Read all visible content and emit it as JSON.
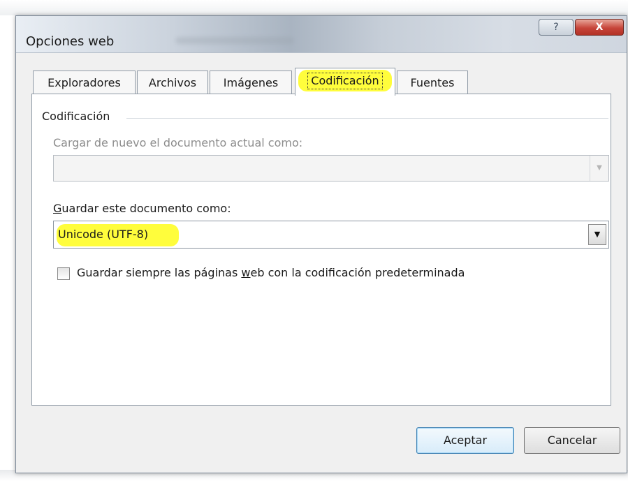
{
  "window": {
    "title": "Opciones web",
    "help_label": "?",
    "close_label": "X"
  },
  "tabs": [
    {
      "label": "Exploradores",
      "active": false
    },
    {
      "label": "Archivos",
      "active": false
    },
    {
      "label": "Imágenes",
      "active": false
    },
    {
      "label": "Codificación",
      "active": true
    },
    {
      "label": "Fuentes",
      "active": false
    }
  ],
  "encoding": {
    "group_label": "Codificación",
    "reload_label": "Cargar de nuevo el documento actual como:",
    "reload_value": "",
    "save_label_first": "G",
    "save_label_rest": "uardar este documento como:",
    "save_value": "Unicode (UTF-8)",
    "always_save_prefix": "Guardar siempre las páginas ",
    "always_save_accel": "w",
    "always_save_suffix": "eb con la codificación predeterminada",
    "always_save_checked": false
  },
  "buttons": {
    "ok": "Aceptar",
    "cancel": "Cancelar"
  },
  "colors": {
    "highlight": "#fffd3c",
    "close_button": "#c7453a"
  },
  "icons": {
    "dropdown": "chevron-down-icon",
    "help": "question-mark-icon",
    "close": "close-icon"
  }
}
